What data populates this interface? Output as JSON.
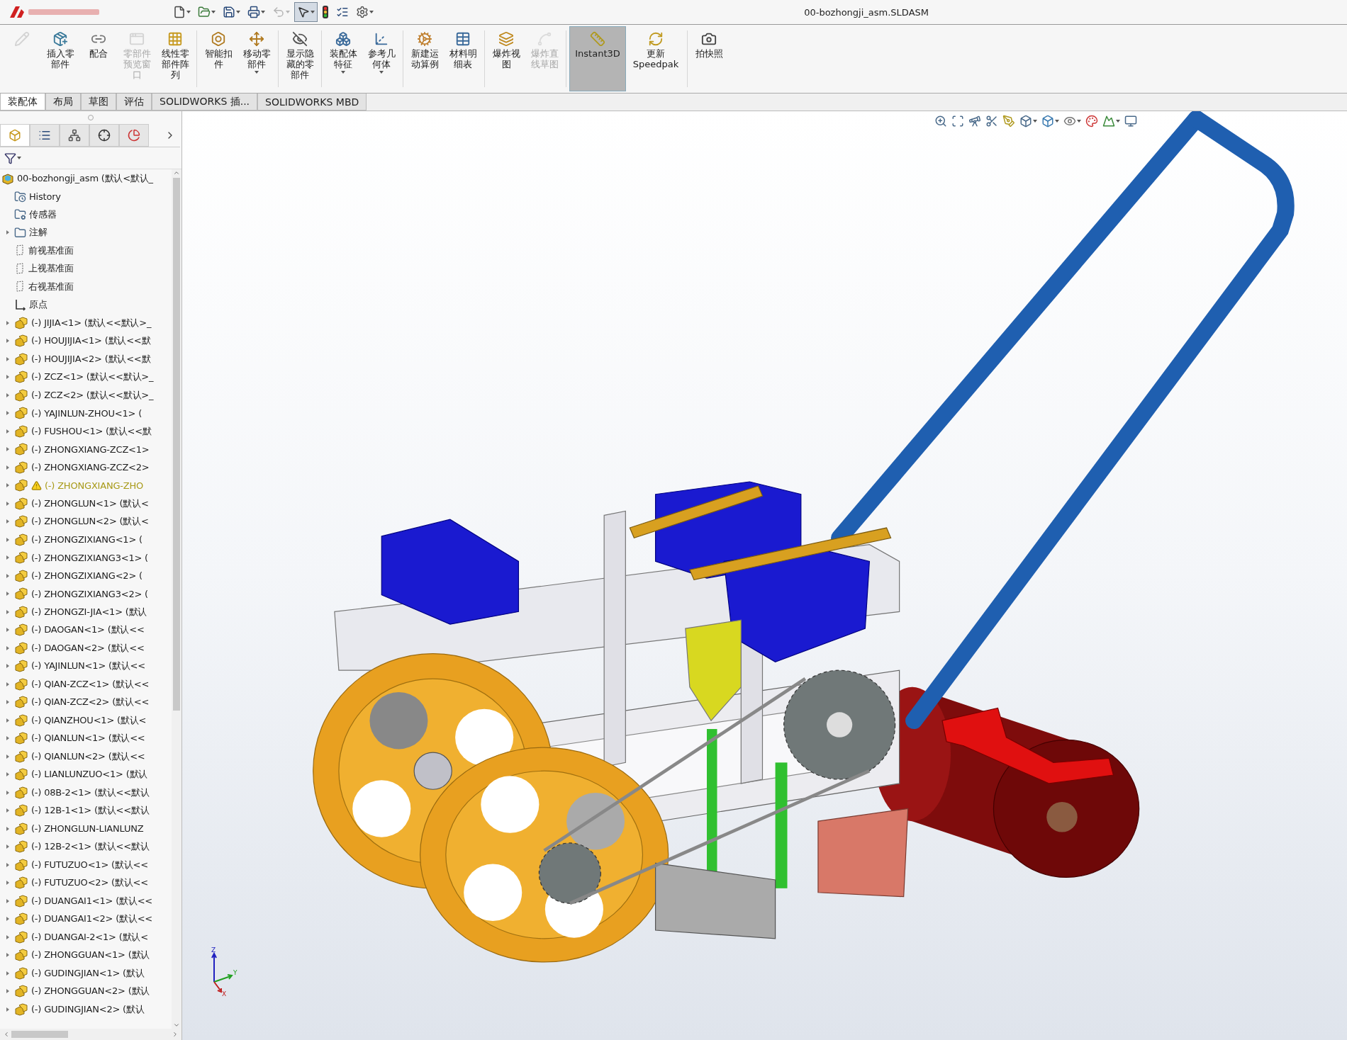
{
  "window": {
    "title": "00-bozhongji_asm.SLDASM"
  },
  "quick_access": [
    {
      "kind": "new",
      "dropdown": true,
      "disabled": false,
      "selected": false
    },
    {
      "kind": "open",
      "dropdown": true,
      "disabled": false,
      "selected": false
    },
    {
      "kind": "save",
      "dropdown": true,
      "disabled": false,
      "selected": false
    },
    {
      "kind": "print",
      "dropdown": true,
      "disabled": false,
      "selected": false
    },
    {
      "kind": "undo",
      "dropdown": true,
      "disabled": true,
      "selected": false
    },
    {
      "kind": "select",
      "dropdown": true,
      "disabled": false,
      "selected": true
    },
    {
      "kind": "rebuild",
      "dropdown": false,
      "disabled": false,
      "selected": false
    },
    {
      "kind": "file-properties",
      "dropdown": false,
      "disabled": false,
      "selected": false
    },
    {
      "kind": "options",
      "dropdown": true,
      "disabled": false,
      "selected": false
    }
  ],
  "command_buttons": [
    {
      "disabled": true,
      "selected": false,
      "dropdown": false
    },
    {
      "label": "插入零部件",
      "disabled": false,
      "selected": false,
      "dropdown": false
    },
    {
      "label": "配合",
      "disabled": false,
      "selected": false,
      "dropdown": false
    },
    {
      "label": "零部件预览窗口",
      "disabled": true,
      "selected": false,
      "dropdown": false
    },
    {
      "label": "线性零部件阵列",
      "disabled": false,
      "selected": false,
      "dropdown": false
    },
    {
      "label": "智能扣件",
      "disabled": false,
      "selected": false,
      "dropdown": false
    },
    {
      "label": "移动零部件",
      "disabled": false,
      "selected": false,
      "dropdown": true
    },
    {
      "label": "显示隐藏的零部件",
      "disabled": false,
      "selected": false,
      "dropdown": false
    },
    {
      "label": "装配体特征",
      "disabled": false,
      "selected": false,
      "dropdown": true
    },
    {
      "label": "参考几何体",
      "disabled": false,
      "selected": false,
      "dropdown": true
    },
    {
      "label": "新建运动算例",
      "disabled": false,
      "selected": false,
      "dropdown": false
    },
    {
      "label": "材料明细表",
      "disabled": false,
      "selected": false,
      "dropdown": false
    },
    {
      "label": "爆炸视图",
      "disabled": false,
      "selected": false,
      "dropdown": false
    },
    {
      "label": "爆炸直线草图",
      "disabled": true,
      "selected": false,
      "dropdown": false
    },
    {
      "label": "Instant3D",
      "disabled": false,
      "selected": true,
      "dropdown": false
    },
    {
      "label": "更新Speedpak",
      "disabled": false,
      "selected": false,
      "dropdown": false
    },
    {
      "label": "拍快照",
      "disabled": false,
      "selected": false,
      "dropdown": false
    }
  ],
  "tabs": [
    {
      "label": "装配体",
      "selected": true
    },
    {
      "label": "布局",
      "selected": false
    },
    {
      "label": "草图",
      "selected": false
    },
    {
      "label": "评估",
      "selected": false
    },
    {
      "label": "SOLIDWORKS 插...",
      "selected": false
    },
    {
      "label": "SOLIDWORKS MBD",
      "selected": false
    }
  ],
  "panel_tabs": [
    {
      "kind": "feature-tree",
      "selected": true
    },
    {
      "kind": "property",
      "selected": false
    },
    {
      "kind": "config",
      "selected": false
    },
    {
      "kind": "dimxpert",
      "selected": false
    },
    {
      "kind": "appearance",
      "selected": false
    }
  ],
  "feature_tree": {
    "root": "00-bozhongji_asm (默认<默认_",
    "items": [
      {
        "kind": "history",
        "label": "History",
        "expandable": false,
        "warning": false
      },
      {
        "kind": "sensor",
        "label": "传感器",
        "expandable": false,
        "warning": false
      },
      {
        "kind": "annotation",
        "label": "注解",
        "expandable": true,
        "warning": false
      },
      {
        "kind": "plane",
        "label": "前视基准面",
        "expandable": false,
        "warning": false
      },
      {
        "kind": "plane",
        "label": "上视基准面",
        "expandable": false,
        "warning": false
      },
      {
        "kind": "plane",
        "label": "右视基准面",
        "expandable": false,
        "warning": false
      },
      {
        "kind": "origin",
        "label": "原点",
        "expandable": false,
        "warning": false
      },
      {
        "kind": "part",
        "label": "(-) JIJIA<1> (默认<<默认>_",
        "expandable": true,
        "warning": false
      },
      {
        "kind": "part",
        "label": "(-) HOUJIJIA<1> (默认<<默",
        "expandable": true,
        "warning": false
      },
      {
        "kind": "part",
        "label": "(-) HOUJIJIA<2> (默认<<默",
        "expandable": true,
        "warning": false
      },
      {
        "kind": "part",
        "label": "(-) ZCZ<1> (默认<<默认>_",
        "expandable": true,
        "warning": false
      },
      {
        "kind": "part",
        "label": "(-) ZCZ<2> (默认<<默认>_",
        "expandable": true,
        "warning": false
      },
      {
        "kind": "part",
        "label": "(-) YAJINLUN-ZHOU<1> (",
        "expandable": true,
        "warning": false
      },
      {
        "kind": "part",
        "label": "(-) FUSHOU<1> (默认<<默",
        "expandable": true,
        "warning": false
      },
      {
        "kind": "part",
        "label": "(-) ZHONGXIANG-ZCZ<1>",
        "expandable": true,
        "warning": false
      },
      {
        "kind": "part",
        "label": "(-) ZHONGXIANG-ZCZ<2>",
        "expandable": true,
        "warning": false
      },
      {
        "kind": "part",
        "label": "(-) ZHONGXIANG-ZHO",
        "expandable": true,
        "warning": true
      },
      {
        "kind": "part",
        "label": "(-) ZHONGLUN<1> (默认<",
        "expandable": true,
        "warning": false
      },
      {
        "kind": "part",
        "label": "(-) ZHONGLUN<2> (默认<",
        "expandable": true,
        "warning": false
      },
      {
        "kind": "part",
        "label": "(-) ZHONGZIXIANG<1> (",
        "expandable": true,
        "warning": false
      },
      {
        "kind": "part",
        "label": "(-) ZHONGZIXIANG3<1> (",
        "expandable": true,
        "warning": false
      },
      {
        "kind": "part",
        "label": "(-) ZHONGZIXIANG<2> (",
        "expandable": true,
        "warning": false
      },
      {
        "kind": "part",
        "label": "(-) ZHONGZIXIANG3<2> (",
        "expandable": true,
        "warning": false
      },
      {
        "kind": "part",
        "label": "(-) ZHONGZI-JIA<1> (默认",
        "expandable": true,
        "warning": false
      },
      {
        "kind": "part",
        "label": "(-) DAOGAN<1> (默认<<",
        "expandable": true,
        "warning": false
      },
      {
        "kind": "part",
        "label": "(-) DAOGAN<2> (默认<<",
        "expandable": true,
        "warning": false
      },
      {
        "kind": "part",
        "label": "(-) YAJINLUN<1> (默认<<",
        "expandable": true,
        "warning": false
      },
      {
        "kind": "part",
        "label": "(-) QIAN-ZCZ<1> (默认<<",
        "expandable": true,
        "warning": false
      },
      {
        "kind": "part",
        "label": "(-) QIAN-ZCZ<2> (默认<<",
        "expandable": true,
        "warning": false
      },
      {
        "kind": "part",
        "label": "(-) QIANZHOU<1> (默认<",
        "expandable": true,
        "warning": false
      },
      {
        "kind": "part",
        "label": "(-) QIANLUN<1> (默认<<",
        "expandable": true,
        "warning": false
      },
      {
        "kind": "part",
        "label": "(-) QIANLUN<2> (默认<<",
        "expandable": true,
        "warning": false
      },
      {
        "kind": "part",
        "label": "(-) LIANLUNZUO<1> (默认",
        "expandable": true,
        "warning": false
      },
      {
        "kind": "part",
        "label": "(-) 08B-2<1> (默认<<默认",
        "expandable": true,
        "warning": false
      },
      {
        "kind": "part",
        "label": "(-) 12B-1<1> (默认<<默认",
        "expandable": true,
        "warning": false
      },
      {
        "kind": "part",
        "label": "(-) ZHONGLUN-LIANLUNZ",
        "expandable": true,
        "warning": false
      },
      {
        "kind": "part",
        "label": "(-) 12B-2<1> (默认<<默认",
        "expandable": true,
        "warning": false
      },
      {
        "kind": "part",
        "label": "(-) FUTUZUO<1> (默认<<",
        "expandable": true,
        "warning": false
      },
      {
        "kind": "part",
        "label": "(-) FUTUZUO<2> (默认<<",
        "expandable": true,
        "warning": false
      },
      {
        "kind": "part",
        "label": "(-) DUANGAI1<1> (默认<<",
        "expandable": true,
        "warning": false
      },
      {
        "kind": "part",
        "label": "(-) DUANGAI1<2> (默认<<",
        "expandable": true,
        "warning": false
      },
      {
        "kind": "part",
        "label": "(-) DUANGAI-2<1> (默认<",
        "expandable": true,
        "warning": false
      },
      {
        "kind": "part",
        "label": "(-) ZHONGGUAN<1> (默认",
        "expandable": true,
        "warning": false
      },
      {
        "kind": "part",
        "label": "(-) GUDINGJIAN<1> (默认",
        "expandable": true,
        "warning": false
      },
      {
        "kind": "part",
        "label": "(-) ZHONGGUAN<2> (默认",
        "expandable": true,
        "warning": false
      },
      {
        "kind": "part",
        "label": "(-) GUDINGJIAN<2> (默认",
        "expandable": true,
        "warning": false
      }
    ]
  },
  "view_toolbar": [
    {
      "kind": "zoom-fit",
      "dropdown": false
    },
    {
      "kind": "zoom-area",
      "dropdown": false
    },
    {
      "kind": "previous-view",
      "dropdown": false
    },
    {
      "kind": "section",
      "dropdown": false
    },
    {
      "kind": "dynamic-annotation",
      "dropdown": false
    },
    {
      "kind": "view-orientation",
      "dropdown": true
    },
    {
      "kind": "display-style",
      "dropdown": true
    },
    {
      "kind": "hide-show",
      "dropdown": true
    },
    {
      "kind": "appearance",
      "dropdown": false
    },
    {
      "kind": "scene",
      "dropdown": true
    },
    {
      "kind": "view-settings",
      "dropdown": false
    }
  ],
  "triad": {
    "z": "Z",
    "y": "Y",
    "x": "X"
  }
}
